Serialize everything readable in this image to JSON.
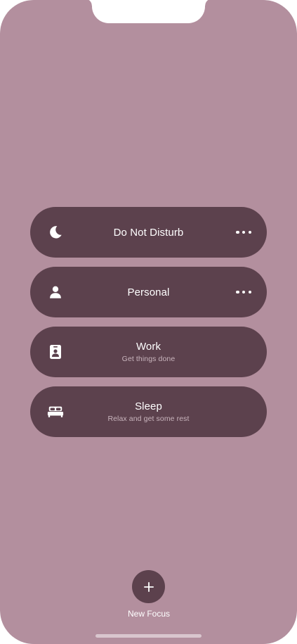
{
  "focus_modes": [
    {
      "title": "Do Not Disturb",
      "subtitle": "",
      "icon": "moon-icon",
      "has_more": true
    },
    {
      "title": "Personal",
      "subtitle": "",
      "icon": "person-icon",
      "has_more": true
    },
    {
      "title": "Work",
      "subtitle": "Get things done",
      "icon": "id-badge-icon",
      "has_more": false
    },
    {
      "title": "Sleep",
      "subtitle": "Relax and get some rest",
      "icon": "bed-icon",
      "has_more": false
    }
  ],
  "new_focus": {
    "label": "New Focus",
    "icon": "plus-icon"
  },
  "colors": {
    "background": "#b38f9e",
    "card": "#5c414d",
    "text": "#ffffff",
    "subtext": "#c9b5bd"
  }
}
